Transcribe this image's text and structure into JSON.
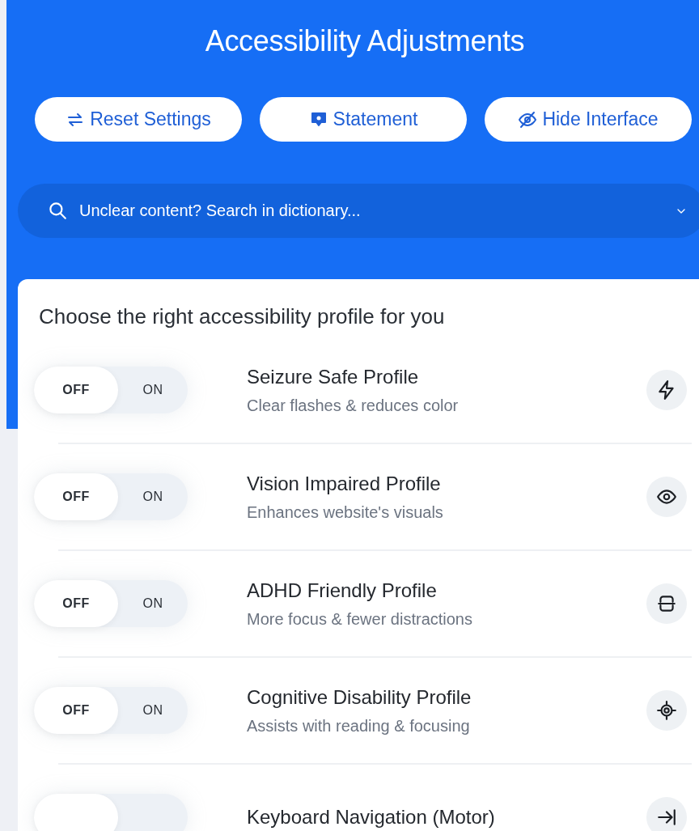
{
  "header": {
    "title": "Accessibility Adjustments"
  },
  "actions": [
    {
      "kind": "reset",
      "label": "Reset Settings"
    },
    {
      "kind": "statement",
      "label": "Statement"
    },
    {
      "kind": "hide",
      "label": "Hide Interface"
    }
  ],
  "search": {
    "placeholder": "Unclear content? Search in dictionary..."
  },
  "profiles_heading": "Choose the right accessibility profile for you",
  "profiles": [
    {
      "off_label": "OFF",
      "on_label": "ON",
      "on": false,
      "title": "Seizure Safe Profile",
      "description": "Clear flashes & reduces color"
    },
    {
      "off_label": "OFF",
      "on_label": "ON",
      "on": false,
      "title": "Vision Impaired Profile",
      "description": "Enhances website's visuals"
    },
    {
      "off_label": "OFF",
      "on_label": "ON",
      "on": false,
      "title": "ADHD Friendly Profile",
      "description": "More focus & fewer distractions"
    },
    {
      "off_label": "OFF",
      "on_label": "ON",
      "on": false,
      "title": "Cognitive Disability Profile",
      "description": "Assists with reading & focusing"
    },
    {
      "on": false,
      "title": "Keyboard Navigation (Motor)"
    }
  ]
}
